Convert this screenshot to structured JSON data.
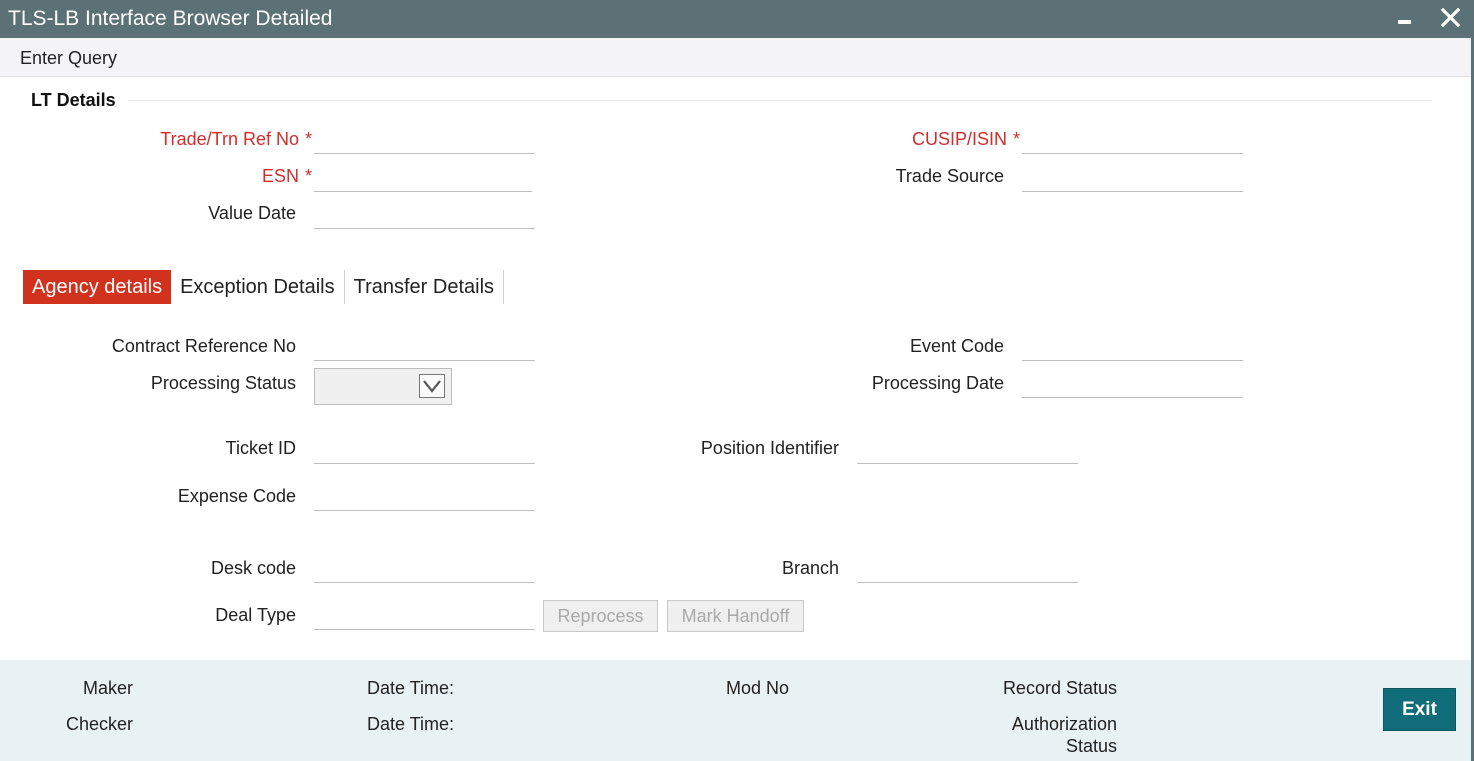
{
  "window": {
    "title": "TLS-LB Interface Browser Detailed"
  },
  "menu": {
    "enter_query": "Enter Query"
  },
  "section": {
    "title": "LT Details"
  },
  "lt_details": {
    "trade_ref_label": "Trade/Trn Ref No",
    "cusip_label": "CUSIP/ISIN",
    "esn_label": "ESN",
    "trade_source_label": "Trade Source",
    "value_date_label": "Value Date",
    "required_marker": "*",
    "trade_ref_value": "",
    "cusip_value": "",
    "esn_value": "",
    "trade_source_value": "",
    "value_date_value": ""
  },
  "tabs": [
    {
      "label": "Agency details",
      "active": true
    },
    {
      "label": "Exception Details",
      "active": false
    },
    {
      "label": "Transfer Details",
      "active": false
    }
  ],
  "agency": {
    "contract_ref_label": "Contract Reference No",
    "event_code_label": "Event Code",
    "processing_status_label": "Processing Status",
    "processing_status_value": "",
    "processing_date_label": "Processing Date",
    "ticket_id_label": "Ticket ID",
    "position_identifier_label": "Position Identifier",
    "expense_code_label": "Expense Code",
    "desk_code_label": "Desk code",
    "branch_label": "Branch",
    "deal_type_label": "Deal Type",
    "reprocess_label": "Reprocess",
    "mark_handoff_label": "Mark Handoff"
  },
  "footer": {
    "maker_label": "Maker",
    "checker_label": "Checker",
    "date_time_label_1": "Date Time:",
    "date_time_label_2": "Date Time:",
    "mod_no_label": "Mod No",
    "record_status_label": "Record Status",
    "authorization_label": "Authorization",
    "status_label": "Status",
    "exit_label": "Exit"
  },
  "colors": {
    "titlebar": "#5b7176",
    "required_label": "#d12d2d",
    "active_tab": "#d0321d",
    "footer_bg": "#e8f1f3",
    "exit_button": "#106c79"
  },
  "icons": {
    "minimize": "minimize-icon",
    "close": "close-icon",
    "dropdown": "chevron-down-icon"
  }
}
